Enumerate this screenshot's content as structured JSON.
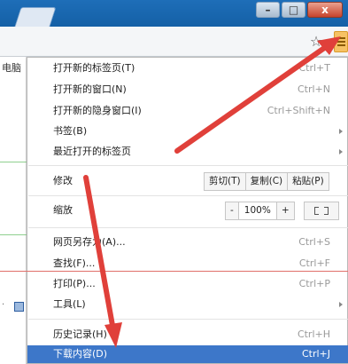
{
  "toolbar": {
    "star_icon": "star-icon",
    "menu_icon": "hamburger-menu-icon"
  },
  "window": {
    "minimize": "–",
    "maximize": "□",
    "close": "x"
  },
  "left_pane": {
    "label": "电脑",
    "dot": "·"
  },
  "menu": {
    "items": [
      {
        "label": "打开新的标签页(T)",
        "shortcut": "Ctrl+T"
      },
      {
        "label": "打开新的窗口(N)",
        "shortcut": "Ctrl+N"
      },
      {
        "label": "打开新的隐身窗口(I)",
        "shortcut": "Ctrl+Shift+N"
      },
      {
        "label": "书签(B)",
        "shortcut": ""
      },
      {
        "label": "最近打开的标签页",
        "shortcut": ""
      }
    ],
    "edit": {
      "label": "修改",
      "cut": "剪切(T)",
      "copy": "复制(C)",
      "paste": "粘贴(P)"
    },
    "zoom": {
      "label": "缩放",
      "minus": "-",
      "value": "100%",
      "plus": "+"
    },
    "items2": [
      {
        "label": "网页另存为(A)...",
        "shortcut": "Ctrl+S"
      },
      {
        "label": "查找(F)...",
        "shortcut": "Ctrl+F"
      },
      {
        "label": "打印(P)...",
        "shortcut": "Ctrl+P"
      },
      {
        "label": "工具(L)",
        "shortcut": ""
      }
    ],
    "items3": [
      {
        "label": "历史记录(H)",
        "shortcut": "Ctrl+H"
      },
      {
        "label": "下载内容(D)",
        "shortcut": "Ctrl+J"
      }
    ]
  },
  "colors": {
    "highlight": "#3d77c9",
    "annotation_arrow": "#e0403a"
  }
}
